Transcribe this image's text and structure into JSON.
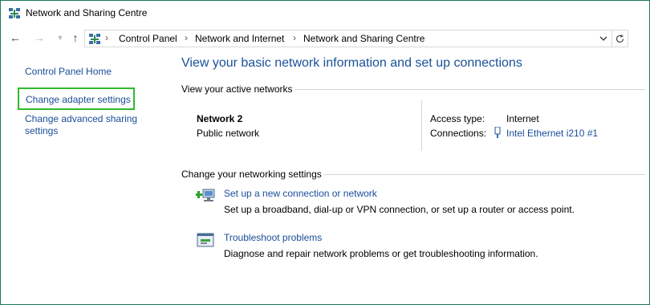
{
  "window": {
    "title": "Network and Sharing Centre"
  },
  "address_bar": {
    "crumbs": [
      "Control Panel",
      "Network and Internet",
      "Network and Sharing Centre"
    ]
  },
  "left_pane": {
    "home_link": "Control Panel Home",
    "adapter_link": "Change adapter settings",
    "advanced_link": "Change advanced sharing settings"
  },
  "main": {
    "title": "View your basic network information and set up connections",
    "active_section": "View your active networks",
    "network": {
      "name": "Network  2",
      "category": "Public network"
    },
    "access_label": "Access type:",
    "access_value": "Internet",
    "connections_label": "Connections:",
    "connections_value": "Intel Ethernet i210 #1",
    "change_section": "Change your networking settings",
    "tasks": [
      {
        "icon": "new-connection-icon",
        "link": "Set up a new connection or network",
        "desc": "Set up a broadband, dial-up or VPN connection, or set up a router or access point."
      },
      {
        "icon": "troubleshoot-icon",
        "link": "Troubleshoot problems",
        "desc": "Diagnose and repair network problems or get troubleshooting information."
      }
    ]
  },
  "colors": {
    "link": "#1a4d99",
    "title": "#1a5099",
    "highlight_box": "#2fba2f",
    "window_border": "#1e7a52"
  }
}
